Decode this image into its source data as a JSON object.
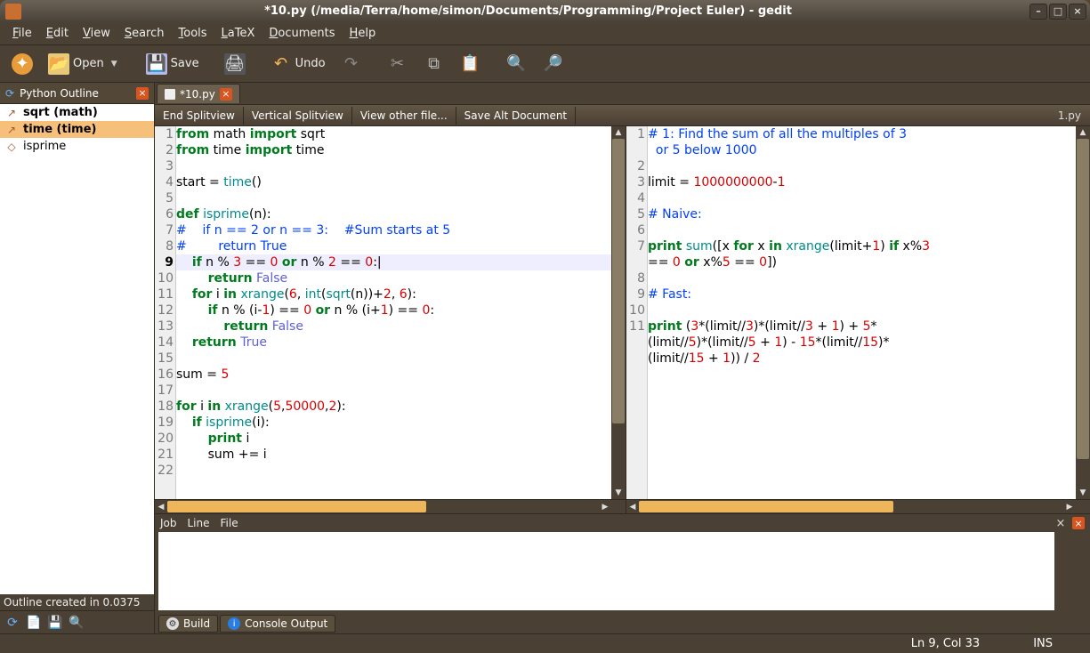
{
  "window": {
    "title": "*10.py (/media/Terra/home/simon/Documents/Programming/Project Euler) - gedit"
  },
  "menu": [
    "File",
    "Edit",
    "View",
    "Search",
    "Tools",
    "LaTeX",
    "Documents",
    "Help"
  ],
  "toolbar": {
    "new": "",
    "open": "Open",
    "save": "Save",
    "print": "",
    "undo": "Undo",
    "redo": "",
    "cut": "",
    "copy": "",
    "paste": "",
    "find": "",
    "findreplace": ""
  },
  "sidebar": {
    "title": "Python Outline",
    "items": [
      {
        "label": "sqrt (math)",
        "bold": true,
        "icon": "↗"
      },
      {
        "label": "time (time)",
        "bold": true,
        "selected": true,
        "icon": "↗"
      },
      {
        "label": "isprime",
        "bold": false,
        "icon": "◇"
      }
    ],
    "status": "Outline created in 0.0375"
  },
  "doctab": {
    "label": "*10.py"
  },
  "secondary_buttons": [
    "End Splitview",
    "Vertical Splitview",
    "View other file...",
    "Save Alt Document"
  ],
  "right_file_label": "1.py",
  "editor_left": {
    "lines": 22,
    "caret_line": 9
  },
  "editor_right": {
    "lines": 11
  },
  "bottom": {
    "columns": [
      "Job",
      "Line",
      "File"
    ],
    "tabs": [
      "Build",
      "Console Output"
    ]
  },
  "status": {
    "position": "Ln 9, Col 33",
    "mode": "INS"
  },
  "code_left_raw": "from math import sqrt\nfrom time import time\n\nstart = time()\n\ndef isprime(n):\n#    if n == 2 or n == 3:    #Sum starts at 5\n#        return True\n    if n % 3 == 0 or n % 2 == 0:|\n        return False\n    for i in xrange(6, int(sqrt(n))+2, 6):\n        if n % (i-1) == 0 or n % (i+1) == 0:\n            return False\n    return True\n\nsum = 5\n\nfor i in xrange(5,50000,2):\n    if isprime(i):\n        print i\n        sum += i\n",
  "code_right_raw": "# 1: Find the sum of all the multiples of 3\n  or 5 below 1000\n\nlimit = 1000000000-1\n\n# Naive:\n\nprint sum([x for x in xrange(limit+1) if x%3\n== 0 or x%5 == 0])\n\n# Fast:\n\nprint (3*(limit//3)*(limit//3 + 1) + 5*\n(limit//5)*(limit//5 + 1) - 15*(limit//15)*\n(limit//15 + 1)) / 2"
}
